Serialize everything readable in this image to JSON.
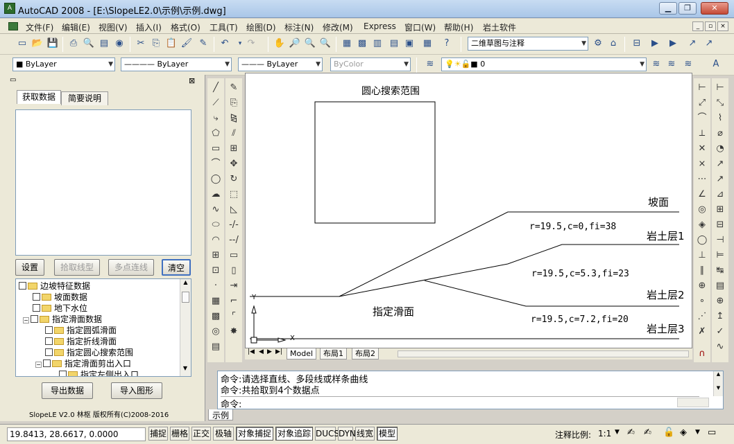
{
  "window": {
    "title": "AutoCAD 2008 - [E:\\SlopeLE2.0\\示例\\示例.dwg]",
    "app_icon": "AutoCAD",
    "minimize": "▁",
    "restore": "❐",
    "close": "✕"
  },
  "menubar": {
    "items": [
      "文件(F)",
      "编辑(E)",
      "视图(V)",
      "插入(I)",
      "格式(O)",
      "工具(T)",
      "绘图(D)",
      "标注(N)",
      "修改(M)",
      "Express",
      "窗口(W)",
      "帮助(H)",
      "岩土软件"
    ],
    "mdi": [
      "_",
      "▫",
      "×"
    ]
  },
  "toolbar1": {
    "workspace": "二维草图与注释"
  },
  "toolbar2": {
    "color": "■ ByLayer",
    "linetype": "———— ByLayer",
    "lineweight": "——— ByLayer",
    "plotstyle": "ByColor",
    "layer": "0"
  },
  "panel": {
    "tabs": [
      "获取数据",
      "简要说明"
    ],
    "buttons": {
      "settings": "设置",
      "pick_linetype": "拾取线型",
      "multi_point": "多点连线",
      "clear": "清空",
      "export": "导出数据",
      "import": "导入图形"
    },
    "tree": [
      {
        "label": "边坡特征数据",
        "level": 0,
        "expander": "□"
      },
      {
        "label": "坡面数据",
        "level": 1
      },
      {
        "label": "地下水位",
        "level": 1
      },
      {
        "label": "指定滑面数据",
        "level": 1,
        "expander": "−"
      },
      {
        "label": "指定圆弧滑面",
        "level": 2
      },
      {
        "label": "指定折线滑面",
        "level": 2
      },
      {
        "label": "指定圆心搜索范围",
        "level": 2
      },
      {
        "label": "指定滑面剪出入口",
        "level": 2,
        "expander": "−"
      },
      {
        "label": "指定左侧出入口",
        "level": 3
      }
    ],
    "footer": "SlopeLE V2.0  林枢  版权所有(C)2008-2016"
  },
  "drawing": {
    "labels": {
      "search_range": "圆心搜索范围",
      "slope_face": "坡面",
      "rock1": "岩土层1",
      "rock2": "岩土层2",
      "rock3": "岩土层3",
      "slip_surface": "指定滑面",
      "param1": "r=19.5,c=0,fi=38",
      "param2": "r=19.5,c=5.3,fi=23",
      "param3": "r=19.5,c=7.2,fi=20",
      "axis_y": "Y",
      "axis_x": "X"
    },
    "layout_tabs": [
      "Model",
      "布局1",
      "布局2"
    ],
    "nav": [
      "|◀",
      "◀",
      "▶",
      "▶|"
    ]
  },
  "command": {
    "lines": [
      "命令:请选择直线、多段线或样条曲线",
      "命令:共拾取到4个数据点",
      "命令:"
    ],
    "tab": "示例"
  },
  "status": {
    "coords": "19.8413, 28.6617, 0.0000",
    "toggles": [
      {
        "label": "捕捉",
        "on": false
      },
      {
        "label": "栅格",
        "on": false
      },
      {
        "label": "正交",
        "on": false
      },
      {
        "label": "极轴",
        "on": false
      },
      {
        "label": "对象捕捉",
        "on": true
      },
      {
        "label": "对象追踪",
        "on": true
      },
      {
        "label": "DUCS",
        "on": false
      },
      {
        "label": "DYN",
        "on": false
      },
      {
        "label": "线宽",
        "on": false
      },
      {
        "label": "模型",
        "on": true
      }
    ],
    "annotation_scale_label": "注释比例:",
    "annotation_scale": "1:1"
  }
}
